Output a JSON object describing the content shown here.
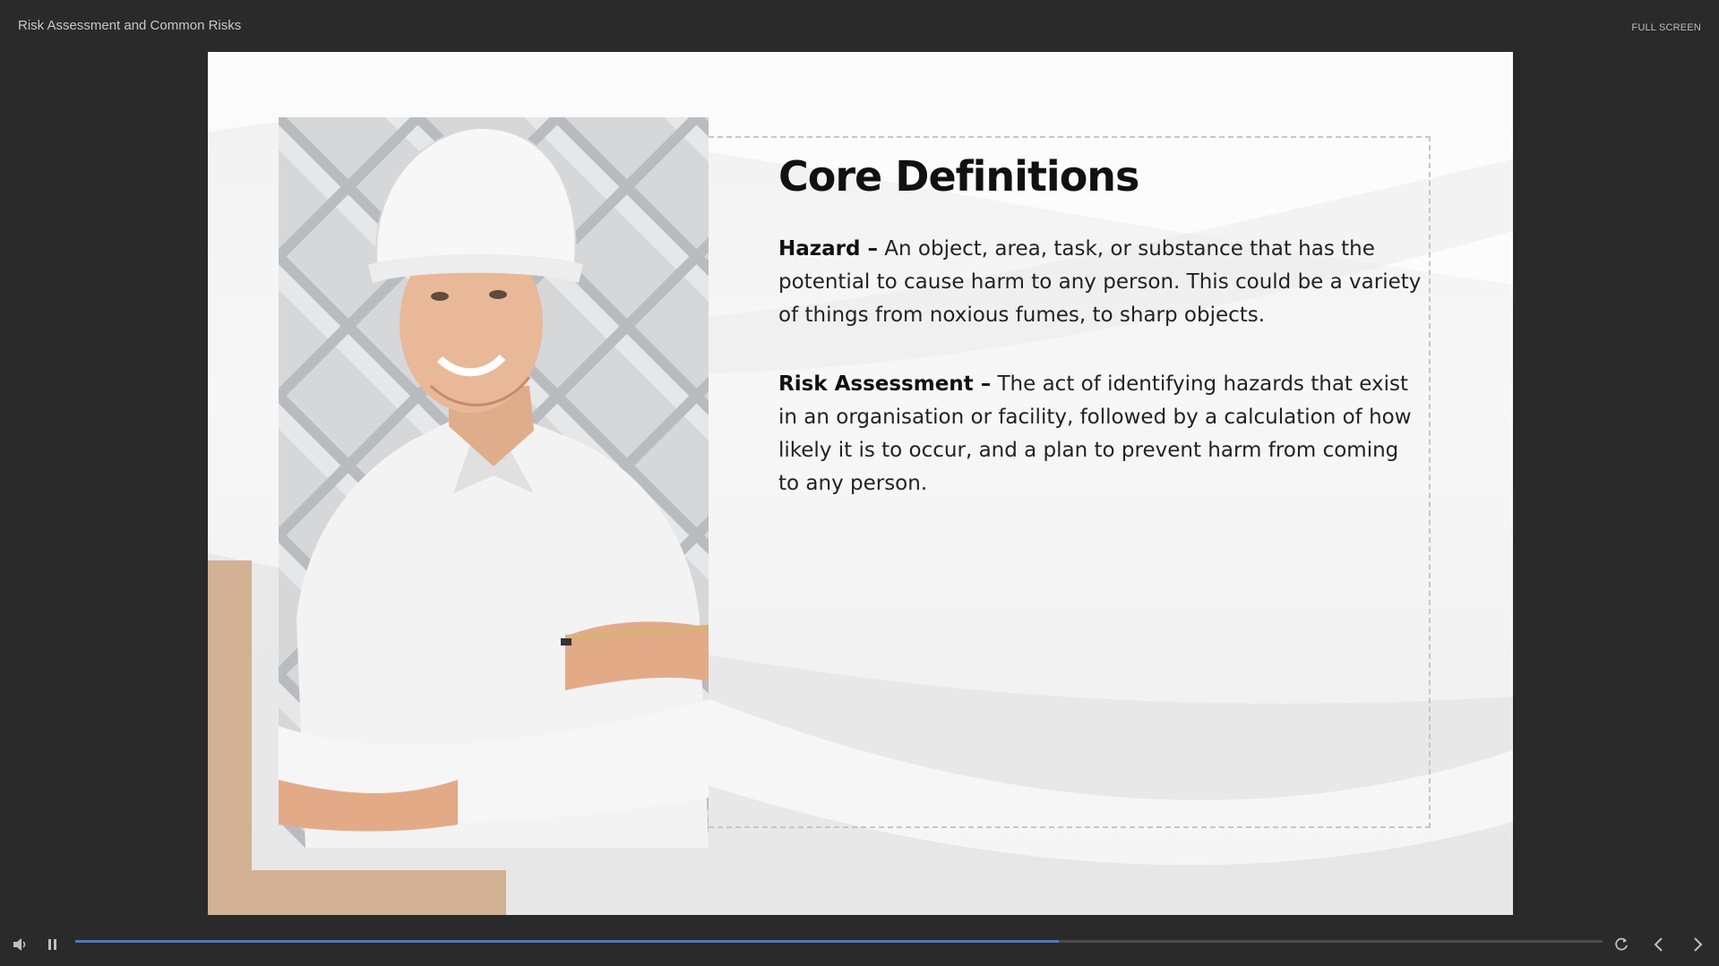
{
  "header": {
    "course_title": "Risk Assessment and Common Risks",
    "fullscreen_label": "FULL SCREEN"
  },
  "slide": {
    "title": "Core Definitions",
    "definitions": [
      {
        "term": "Hazard –",
        "text": " An object, area, task, or substance that has the potential to cause harm to any person. This could be a variety of things from noxious fumes, to sharp objects."
      },
      {
        "term": "Risk Assessment –",
        "text": " The act of identifying hazards that exist in an organisation or facility, followed by a calculation of how likely it is to occur, and a plan to prevent harm from coming to any person."
      }
    ],
    "accent_color": "#d2b195"
  },
  "player": {
    "progress": 0.644,
    "progress_color": "#4c79c4",
    "icons": [
      "volume-icon",
      "pause-icon",
      "replay-icon",
      "previous-icon",
      "next-icon"
    ]
  }
}
